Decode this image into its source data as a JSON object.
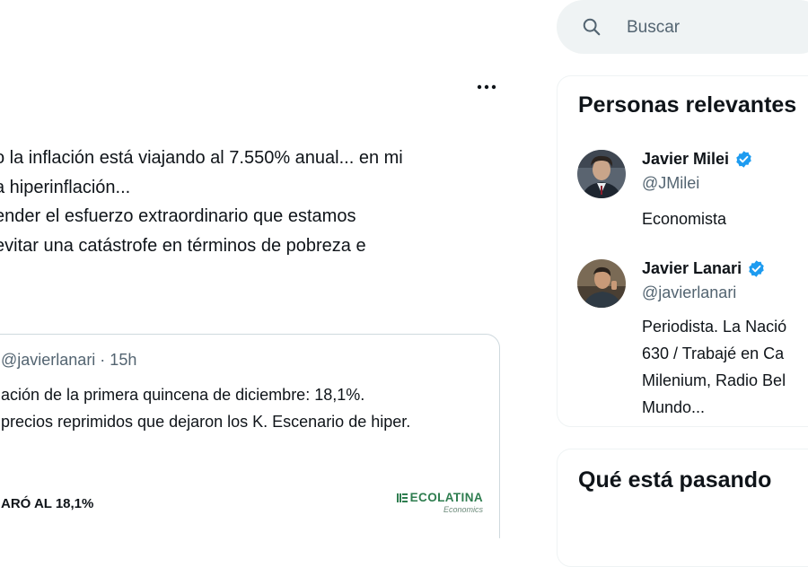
{
  "tweet": {
    "lines": [
      "o la inflación está viajando al 7.550% anual... en mi",
      "a hiperinflación...",
      "ender el esfuerzo extraordinario que estamos",
      "evitar una catástrofe en términos de pobreza e"
    ],
    "more_icon": "more-horizontal-icon"
  },
  "quote": {
    "author_meta": "@javierlanari · 15h",
    "text_lines": [
      "ación de la primera quincena de diciembre: 18,1%.",
      "precios reprimidos que dejaron los K. Escenario de hiper."
    ],
    "media_headline": "ARÓ AL 18,1%",
    "logo_text": "ECOLATINA",
    "logo_subtext": "Economics",
    "logo_color": "#2e7d4f"
  },
  "search": {
    "placeholder": "Buscar",
    "icon": "search-icon"
  },
  "relevant_people": {
    "title": "Personas relevantes",
    "people": [
      {
        "name": "Javier Milei",
        "handle": "@JMilei",
        "bio_lines": [
          "Economista"
        ],
        "verified": true
      },
      {
        "name": "Javier Lanari",
        "handle": "@javierlanari",
        "bio_lines": [
          "Periodista. La Nació",
          "630 / Trabajé en Ca",
          "Milenium, Radio Bel",
          "Mundo..."
        ],
        "verified": true
      }
    ]
  },
  "trends": {
    "title": "Qué está pasando"
  },
  "colors": {
    "text_primary": "#0f1419",
    "text_secondary": "#536471",
    "verified_badge": "#1d9bf0",
    "border": "#cfd9de",
    "search_bg": "#eff3f4"
  }
}
